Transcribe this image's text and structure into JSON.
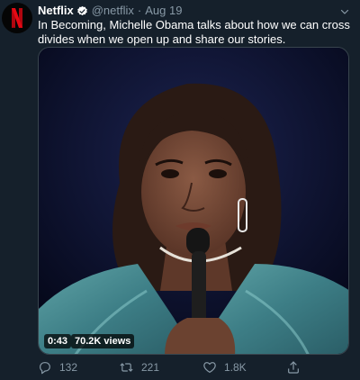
{
  "tweet": {
    "author": {
      "display_name": "Netflix",
      "handle": "@netflix",
      "verified": true,
      "avatar_letter": "N",
      "brand_color": "#e50914"
    },
    "separator": "·",
    "date": "Aug 19",
    "text": "In Becoming, Michelle Obama talks about how we can cross divides when we open up and share our stories.",
    "media": {
      "type": "video",
      "duration": "0:43",
      "views": "70.2K views"
    },
    "actions": {
      "replies": "132",
      "retweets": "221",
      "likes": "1.8K"
    },
    "icons": {
      "verified": "verified-badge-icon",
      "caret": "chevron-down-icon",
      "reply": "reply-icon",
      "retweet": "retweet-icon",
      "like": "heart-icon",
      "share": "share-icon"
    }
  },
  "colors": {
    "background": "#15202b",
    "text_primary": "#ffffff",
    "text_secondary": "#8899a6",
    "verified": "#ffffff"
  }
}
